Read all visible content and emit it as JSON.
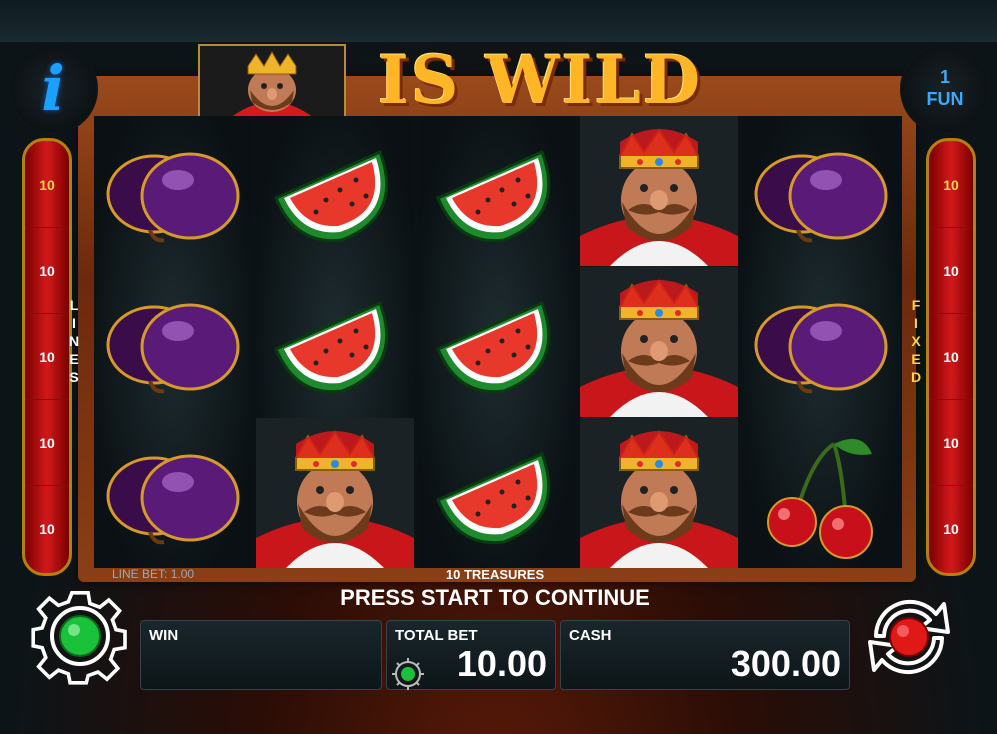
{
  "banner": {
    "wild_text": "IS WILD"
  },
  "buttons": {
    "fun_count": "1",
    "fun_label": "FUN"
  },
  "left_bar": {
    "label": "LINES",
    "values": [
      "10",
      "10",
      "10",
      "10",
      "10"
    ]
  },
  "right_bar": {
    "label": "FIXED",
    "values": [
      "10",
      "10",
      "10",
      "10",
      "10"
    ]
  },
  "reels": [
    [
      "plum",
      "plum",
      "plum"
    ],
    [
      "watermelon",
      "watermelon",
      "king"
    ],
    [
      "watermelon",
      "watermelon",
      "watermelon"
    ],
    [
      "king",
      "king",
      "king"
    ],
    [
      "plum",
      "plum",
      "cherries"
    ]
  ],
  "footer": {
    "line_bet": "LINE BET: 1.00",
    "game_name": "10 TREASURES",
    "status": "PRESS START TO CONTINUE",
    "win_label": "WIN",
    "win_value": "",
    "total_bet_label": "TOTAL BET",
    "total_bet_value": "10.00",
    "cash_label": "CASH",
    "cash_value": "300.00"
  },
  "colors": {
    "accent_gold": "#ffb626",
    "bar_red": "#d2191b",
    "start_green": "#19c23a",
    "spin_red": "#e01818"
  },
  "icons": {
    "info": "info-i-icon",
    "settings": "gear-icon",
    "spin": "spin-arrows-icon"
  }
}
